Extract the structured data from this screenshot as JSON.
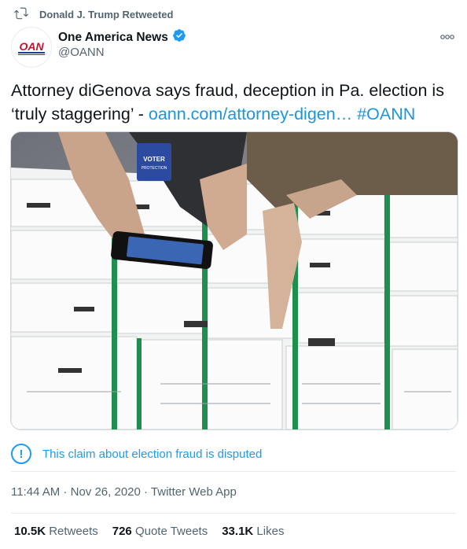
{
  "retweet": {
    "icon": "retweet-icon",
    "text": "Donald J. Trump Retweeted"
  },
  "author": {
    "name": "One America News",
    "handle": "@OANN",
    "verified_icon": "verified-badge-icon",
    "avatar_logo_text": "OAN"
  },
  "more_icon": "more-options-icon",
  "tweet": {
    "text": "Attorney diGenova says fraud, deception in Pa. election is ‘truly staggering’ - ",
    "link": "oann.com/attorney-digen…",
    "hashtag": "#OANN"
  },
  "media": {
    "badge_text": "VOTER",
    "badge_sub": "PROTECTION"
  },
  "notice": {
    "icon": "info-icon",
    "icon_glyph": "!",
    "text": "This claim about election fraud is disputed"
  },
  "meta": {
    "time": "11:44 AM",
    "sep1": " · ",
    "date": "Nov 26, 2020",
    "sep2": " · ",
    "app": "Twitter Web App"
  },
  "stats": {
    "retweets_count": "10.5K",
    "retweets_label": "Retweets",
    "quotes_count": "726",
    "quotes_label": "Quote Tweets",
    "likes_count": "33.1K",
    "likes_label": "Likes"
  },
  "colors": {
    "link": "#1b95e0",
    "secondary_text": "#536471",
    "verified": "#1d9bf0"
  }
}
